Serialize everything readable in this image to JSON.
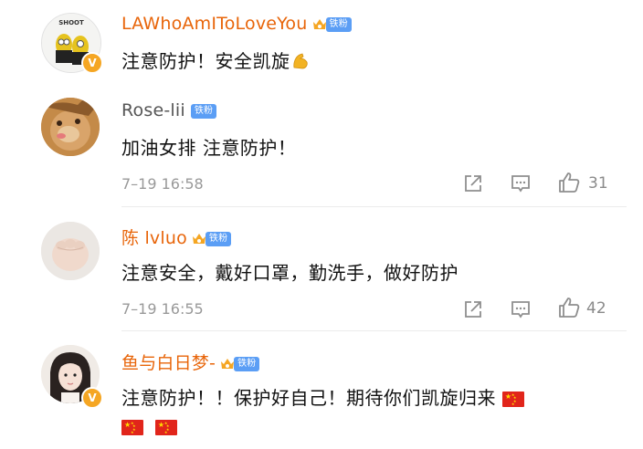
{
  "comments": [
    {
      "username": "LAWhoAmIToLoveYou",
      "badge": "铁粉",
      "text": "注意防护！安全凯旋",
      "avatar_label": "SHOOT",
      "verified": true
    },
    {
      "username": "Rose-lii",
      "badge": "铁粉",
      "text": "加油女排 注意防护！",
      "time": "7–19 16:58",
      "likes": "31"
    },
    {
      "username": "陈 lvluo",
      "badge": "铁粉",
      "text": "注意安全，戴好口罩，勤洗手，做好防护",
      "time": "7–19 16:55",
      "likes": "42"
    },
    {
      "username": "鱼与白日梦-",
      "badge": "铁粉",
      "text": "注意防护！！保护好自己！期待你们凯旋归来",
      "verified": true
    }
  ],
  "colors": {
    "username_orange": "#e8650a",
    "badge_blue": "#5b9ef5",
    "meta_gray": "#999999"
  },
  "icons": [
    "share-icon",
    "comment-icon",
    "like-icon",
    "verified-icon",
    "crown-icon",
    "flexed-biceps-emoji",
    "china-flag-emoji"
  ]
}
